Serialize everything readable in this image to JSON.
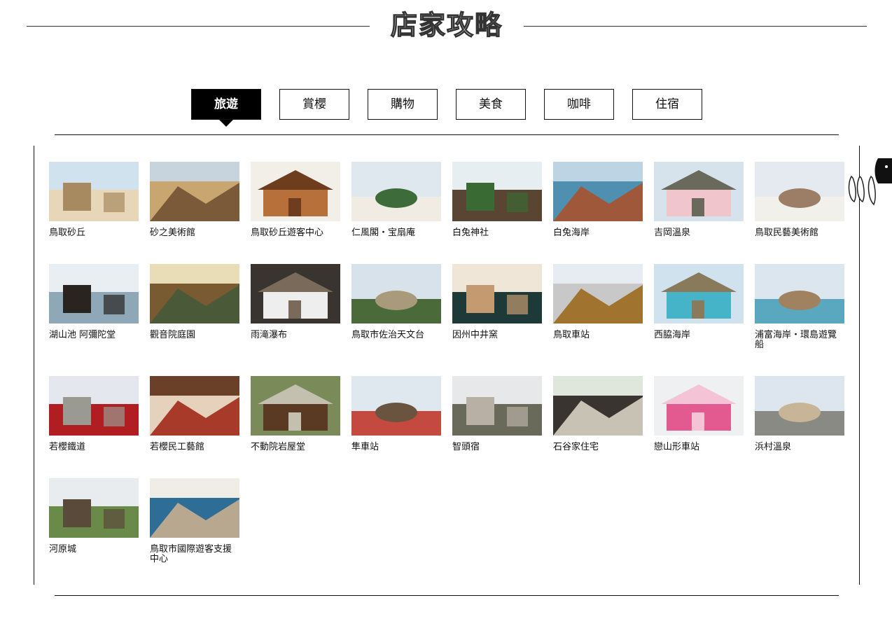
{
  "header": {
    "title": "店家攻略"
  },
  "tabs": [
    {
      "label": "旅遊",
      "active": true
    },
    {
      "label": "賞櫻",
      "active": false
    },
    {
      "label": "購物",
      "active": false
    },
    {
      "label": "美食",
      "active": false
    },
    {
      "label": "咖啡",
      "active": false
    },
    {
      "label": "住宿",
      "active": false
    }
  ],
  "side_badge": {
    "icon": "rabbit-mascot-icon"
  },
  "spots": [
    {
      "name": "鳥取砂丘",
      "palette": [
        "#cfe2ee",
        "#e8d6b8",
        "#a88a60"
      ]
    },
    {
      "name": "砂之美術館",
      "palette": [
        "#c7d4de",
        "#c9a66f",
        "#7a5a38"
      ]
    },
    {
      "name": "鳥取砂丘遊客中心",
      "palette": [
        "#f2efe8",
        "#b8703a",
        "#6e3d1e"
      ]
    },
    {
      "name": "仁風閣・宝扇庵",
      "palette": [
        "#dfe8ee",
        "#f0ece4",
        "#3e6b3a"
      ]
    },
    {
      "name": "白兔神社",
      "palette": [
        "#e6eef2",
        "#5a4432",
        "#3a6a34"
      ]
    },
    {
      "name": "白兔海岸",
      "palette": [
        "#bcd4e4",
        "#4f8fb0",
        "#a0583a"
      ]
    },
    {
      "name": "吉岡溫泉",
      "palette": [
        "#d6e2ec",
        "#f0c6cc",
        "#6a6a5c"
      ]
    },
    {
      "name": "鳥取民藝美術館",
      "palette": [
        "#e4eaf0",
        "#f2f0ea",
        "#9c7e66"
      ]
    },
    {
      "name": "湖山池 阿彌陀堂",
      "palette": [
        "#e8eef2",
        "#8ea8b8",
        "#2a2420"
      ]
    },
    {
      "name": "觀音院庭園",
      "palette": [
        "#e9ddb8",
        "#7a5a30",
        "#4a5a38"
      ]
    },
    {
      "name": "雨滝瀑布",
      "palette": [
        "#3a3430",
        "#eeeeee",
        "#7a6a5a"
      ]
    },
    {
      "name": "鳥取市佐治天文台",
      "palette": [
        "#d8e2ea",
        "#4a6a3a",
        "#a89a7a"
      ]
    },
    {
      "name": "因州中井窯",
      "palette": [
        "#f0e6d8",
        "#1e3a38",
        "#c49a70"
      ]
    },
    {
      "name": "鳥取車站",
      "palette": [
        "#e6ecf2",
        "#c8c8c8",
        "#a0742e"
      ]
    },
    {
      "name": "西脇海岸",
      "palette": [
        "#cfe2ee",
        "#46b4c8",
        "#8a7a5c"
      ]
    },
    {
      "name": "浦富海岸・環島遊覽船",
      "palette": [
        "#dbe6ee",
        "#5aa8c0",
        "#a08260"
      ]
    },
    {
      "name": "若櫻鐵道",
      "palette": [
        "#e4e8ee",
        "#b01e22",
        "#9a9a92"
      ]
    },
    {
      "name": "若櫻民工藝館",
      "palette": [
        "#6a4028",
        "#e6d2bc",
        "#a83a2a"
      ]
    },
    {
      "name": "不動院岩屋堂",
      "palette": [
        "#7a8a58",
        "#5a3a22",
        "#c4c0b0"
      ]
    },
    {
      "name": "隼車站",
      "palette": [
        "#dfe8ee",
        "#c44a40",
        "#6a5440"
      ]
    },
    {
      "name": "智頭宿",
      "palette": [
        "#e6e8ea",
        "#6a6a5a",
        "#b8b0a4"
      ]
    },
    {
      "name": "石谷家住宅",
      "palette": [
        "#dfe6dc",
        "#3a3430",
        "#c8c2b4"
      ]
    },
    {
      "name": "戀山形車站",
      "palette": [
        "#eef0f2",
        "#e25a90",
        "#f4c4d6"
      ]
    },
    {
      "name": "浜村溫泉",
      "palette": [
        "#dde6ee",
        "#8a8a84",
        "#c8b496"
      ]
    },
    {
      "name": "河原城",
      "palette": [
        "#e8ecee",
        "#6a8a4a",
        "#5a4a3a"
      ]
    },
    {
      "name": "鳥取市國際遊客支援中心",
      "palette": [
        "#f0ede6",
        "#2e6e96",
        "#b8a890"
      ]
    }
  ]
}
